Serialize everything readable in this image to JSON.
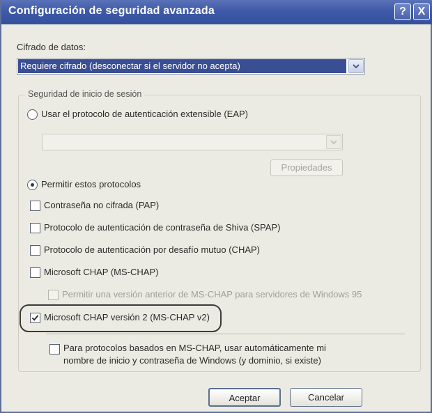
{
  "window": {
    "title": "Configuración de seguridad avanzada",
    "help_glyph": "?",
    "close_glyph": "X"
  },
  "encryption": {
    "label": "Cifrado de datos:",
    "selected": "Requiere cifrado (desconectar si el servidor no acepta)"
  },
  "logon_security": {
    "legend": "Seguridad de inicio de sesión",
    "eap_radio_label": "Usar el protocolo de autenticación extensible (EAP)",
    "eap_radio_checked": false,
    "eap_select_value": "",
    "properties_button": "Propiedades",
    "allow_radio_label": "Permitir estos protocolos",
    "allow_radio_checked": true,
    "protocols": [
      {
        "label": "Contraseña no cifrada (PAP)",
        "checked": false,
        "enabled": true
      },
      {
        "label": "Protocolo de autenticación de contraseña de Shiva (SPAP)",
        "checked": false,
        "enabled": true
      },
      {
        "label": "Protocolo de autenticación por desafío mutuo (CHAP)",
        "checked": false,
        "enabled": true
      },
      {
        "label": "Microsoft CHAP (MS-CHAP)",
        "checked": false,
        "enabled": true
      },
      {
        "label": "Permitir una versión anterior de MS-CHAP para servidores de Windows 95",
        "checked": false,
        "enabled": false
      },
      {
        "label": "Microsoft CHAP versión 2 (MS-CHAP v2)",
        "checked": true,
        "enabled": true
      }
    ],
    "auto_windows_logon_line1": "Para protocolos basados en MS-CHAP, usar automáticamente mi",
    "auto_windows_logon_line2": "nombre de inicio y contraseña de Windows (y dominio, si existe)",
    "auto_windows_logon_checked": false
  },
  "buttons": {
    "ok": "Aceptar",
    "cancel": "Cancelar"
  }
}
